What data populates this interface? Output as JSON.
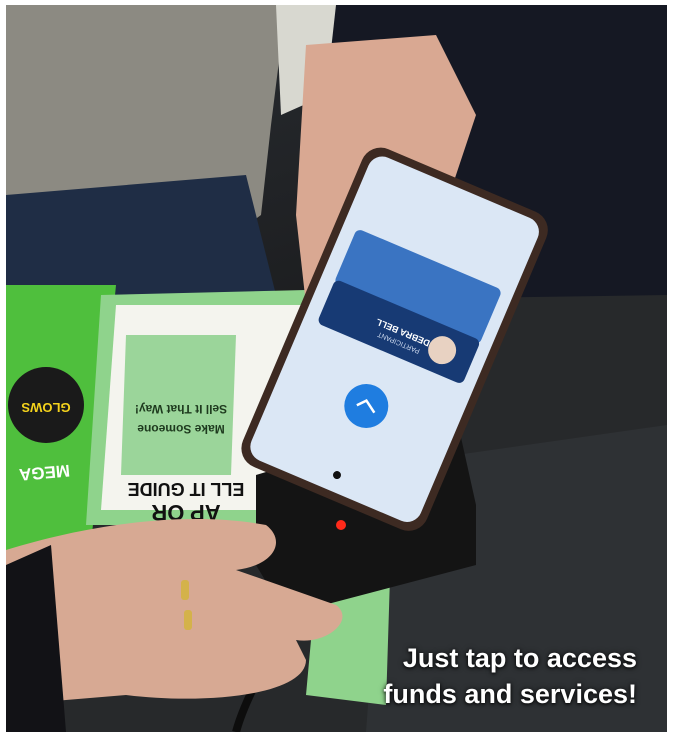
{
  "caption": {
    "line1": "Just tap to access",
    "line2": "funds and services!"
  },
  "phone_card": {
    "name": "DEBRA BELL",
    "subtitle": "PARTICIPANT"
  },
  "booklet": {
    "title_a": "AP OR",
    "title_b": "ELL IT GUIDE",
    "body_a": "Make Someone",
    "body_b": "Sell It That Way!"
  },
  "candy": {
    "text_a": "GLOWS",
    "text_b": "MEGA"
  },
  "colors": {
    "accent_blue": "#1f7de0",
    "screen": "#dbe7f5",
    "booklet_green": "#8fd38c",
    "reader_led": "#ff2a1a"
  }
}
